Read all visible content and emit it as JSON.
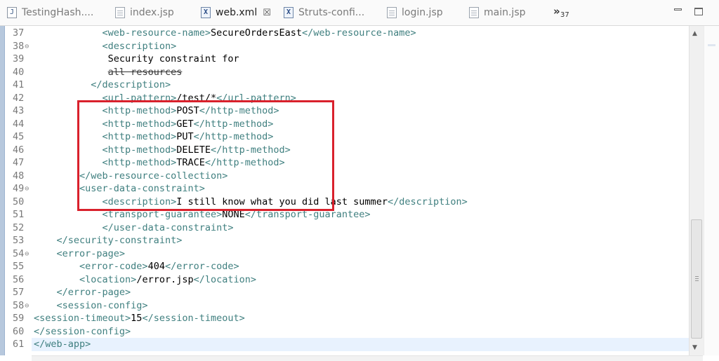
{
  "tabs": [
    {
      "label": "TestingHash....",
      "icon": "java-file-icon",
      "active": false
    },
    {
      "label": "index.jsp",
      "icon": "jsp-file-icon",
      "active": false
    },
    {
      "label": "web.xml",
      "icon": "xml-file-icon",
      "active": true
    },
    {
      "label": "Struts-confi...",
      "icon": "xml-file-icon",
      "active": false
    },
    {
      "label": "login.jsp",
      "icon": "jsp-file-icon",
      "active": false
    },
    {
      "label": "main.jsp",
      "icon": "jsp-file-icon",
      "active": false
    }
  ],
  "tab_overflow": {
    "glyph": "»",
    "count": "37"
  },
  "window_controls": {
    "minimize": "minimize-icon",
    "maximize": "maximize-icon"
  },
  "highlight": {
    "color": "#d9212c",
    "from_line": "41",
    "to_line": "48"
  },
  "lines": [
    {
      "n": "37",
      "fold": "",
      "parts": [
        [
          "t",
          "            "
        ],
        [
          "g",
          "<web-resource-name>"
        ],
        [
          "t",
          "SecureOrdersEast"
        ],
        [
          "g",
          "</web-resource-name>"
        ]
      ]
    },
    {
      "n": "38",
      "fold": "⊖",
      "parts": [
        [
          "t",
          "            "
        ],
        [
          "g",
          "<description>"
        ]
      ]
    },
    {
      "n": "39",
      "fold": "",
      "parts": [
        [
          "t",
          "             Security constraint for"
        ]
      ]
    },
    {
      "n": "40",
      "fold": "",
      "parts": [
        [
          "t",
          "             "
        ],
        [
          "s",
          "all resources"
        ]
      ]
    },
    {
      "n": "41",
      "fold": "",
      "parts": [
        [
          "t",
          "          "
        ],
        [
          "g",
          "</description>"
        ]
      ]
    },
    {
      "n": "42",
      "fold": "",
      "parts": [
        [
          "t",
          "            "
        ],
        [
          "g",
          "<url-pattern>"
        ],
        [
          "t",
          "/test/*"
        ],
        [
          "g",
          "</url-pattern>"
        ]
      ]
    },
    {
      "n": "43",
      "fold": "",
      "parts": [
        [
          "t",
          "            "
        ],
        [
          "g",
          "<http-method>"
        ],
        [
          "t",
          "POST"
        ],
        [
          "g",
          "</http-method>"
        ]
      ]
    },
    {
      "n": "44",
      "fold": "",
      "parts": [
        [
          "t",
          "            "
        ],
        [
          "g",
          "<http-method>"
        ],
        [
          "t",
          "GET"
        ],
        [
          "g",
          "</http-method>"
        ]
      ]
    },
    {
      "n": "45",
      "fold": "",
      "parts": [
        [
          "t",
          "            "
        ],
        [
          "g",
          "<http-method>"
        ],
        [
          "t",
          "PUT"
        ],
        [
          "g",
          "</http-method>"
        ]
      ]
    },
    {
      "n": "46",
      "fold": "",
      "parts": [
        [
          "t",
          "            "
        ],
        [
          "g",
          "<http-method>"
        ],
        [
          "t",
          "DELETE"
        ],
        [
          "g",
          "</http-method>"
        ]
      ]
    },
    {
      "n": "47",
      "fold": "",
      "parts": [
        [
          "t",
          "            "
        ],
        [
          "g",
          "<http-method>"
        ],
        [
          "t",
          "TRACE"
        ],
        [
          "g",
          "</http-method>"
        ]
      ]
    },
    {
      "n": "48",
      "fold": "",
      "parts": [
        [
          "t",
          "        "
        ],
        [
          "g",
          "</web-resource-collection>"
        ]
      ]
    },
    {
      "n": "49",
      "fold": "⊖",
      "parts": [
        [
          "t",
          "        "
        ],
        [
          "g",
          "<user-data-constraint>"
        ]
      ]
    },
    {
      "n": "50",
      "fold": "",
      "parts": [
        [
          "t",
          "            "
        ],
        [
          "g",
          "<description>"
        ],
        [
          "t",
          "I still know what you did last summer"
        ],
        [
          "g",
          "</description>"
        ]
      ]
    },
    {
      "n": "51",
      "fold": "",
      "parts": [
        [
          "t",
          "            "
        ],
        [
          "g",
          "<transport-guarantee>"
        ],
        [
          "t",
          "NONE"
        ],
        [
          "g",
          "</transport-guarantee>"
        ]
      ]
    },
    {
      "n": "52",
      "fold": "",
      "parts": [
        [
          "t",
          "            "
        ],
        [
          "g",
          "</user-data-constraint>"
        ]
      ]
    },
    {
      "n": "53",
      "fold": "",
      "parts": [
        [
          "t",
          "    "
        ],
        [
          "g",
          "</security-constraint>"
        ]
      ]
    },
    {
      "n": "54",
      "fold": "⊖",
      "parts": [
        [
          "t",
          "    "
        ],
        [
          "g",
          "<error-page>"
        ]
      ]
    },
    {
      "n": "55",
      "fold": "",
      "parts": [
        [
          "t",
          "        "
        ],
        [
          "g",
          "<error-code>"
        ],
        [
          "t",
          "404"
        ],
        [
          "g",
          "</error-code>"
        ]
      ]
    },
    {
      "n": "56",
      "fold": "",
      "parts": [
        [
          "t",
          "        "
        ],
        [
          "g",
          "<location>"
        ],
        [
          "t",
          "/error.jsp"
        ],
        [
          "g",
          "</location>"
        ]
      ]
    },
    {
      "n": "57",
      "fold": "",
      "parts": [
        [
          "t",
          "    "
        ],
        [
          "g",
          "</error-page>"
        ]
      ]
    },
    {
      "n": "58",
      "fold": "⊖",
      "parts": [
        [
          "t",
          "    "
        ],
        [
          "g",
          "<session-config>"
        ]
      ]
    },
    {
      "n": "59",
      "fold": "",
      "parts": [
        [
          "g",
          "<session-timeout>"
        ],
        [
          "t",
          "15"
        ],
        [
          "g",
          "</session-timeout>"
        ]
      ]
    },
    {
      "n": "60",
      "fold": "",
      "parts": [
        [
          "g",
          "</session-config>"
        ]
      ]
    },
    {
      "n": "61",
      "fold": "",
      "current": true,
      "parts": [
        [
          "g",
          "</web-app>"
        ]
      ]
    }
  ]
}
